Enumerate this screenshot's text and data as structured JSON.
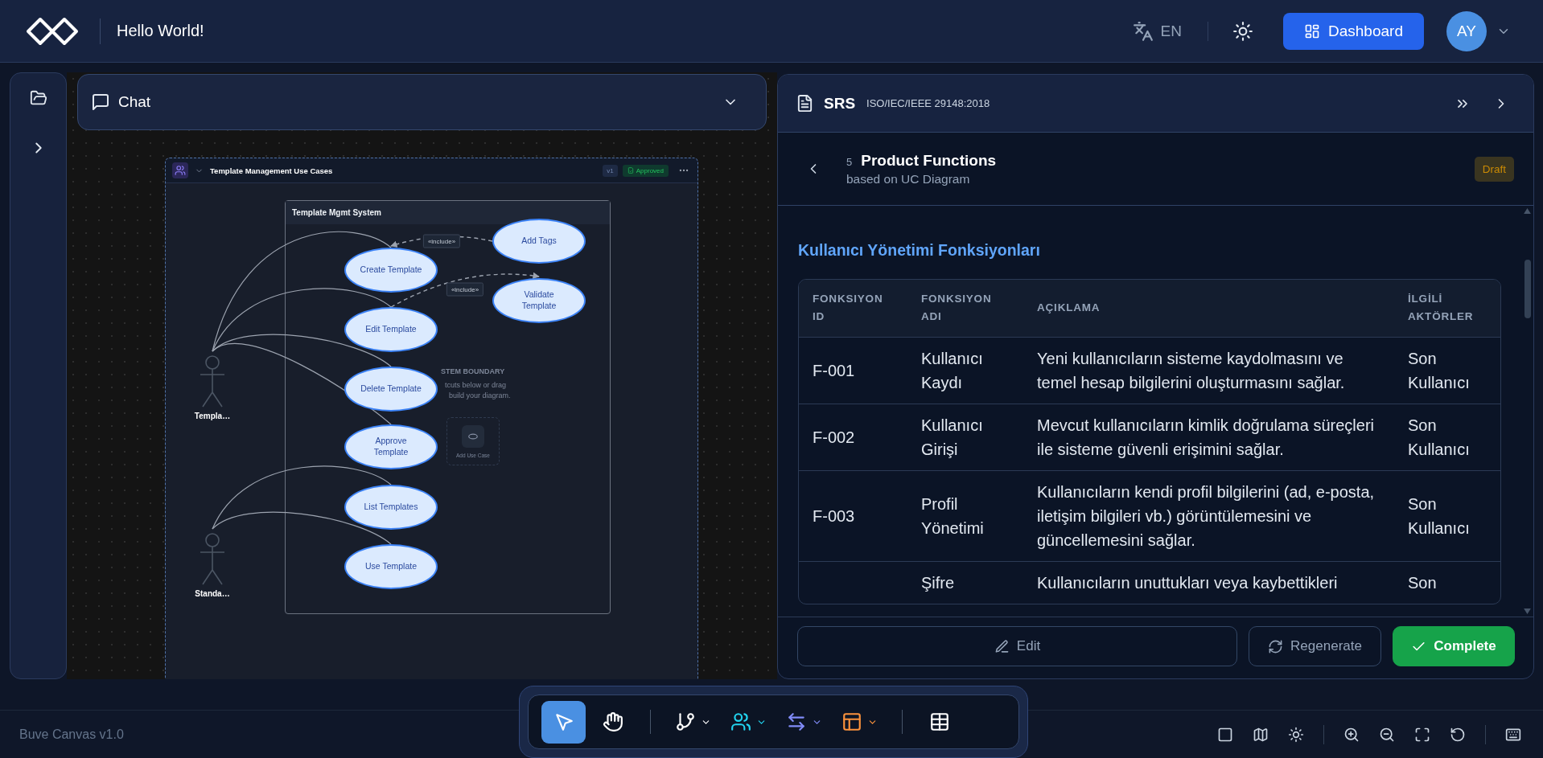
{
  "header": {
    "app_title": "Hello World!",
    "language": "EN",
    "dashboard_button": "Dashboard",
    "avatar_initials": "AY"
  },
  "sidebar": {
    "expanded": false
  },
  "chat": {
    "title": "Chat"
  },
  "diagram": {
    "title": "Template Management Use Cases",
    "version": "v1",
    "status": "Approved",
    "boundary_title": "Template Mgmt System",
    "hint_lines": [
      "STEM BOUNDARY",
      "tcuts below or drag",
      "build your diagram."
    ],
    "add_use_case": "Add Use Case",
    "use_cases": [
      {
        "label": "Create Template"
      },
      {
        "label": "Edit Template"
      },
      {
        "label": "Delete Template"
      },
      {
        "label": "Approve Template"
      },
      {
        "label": "List Templates"
      },
      {
        "label": "Use Template"
      },
      {
        "label": "Add Tags"
      },
      {
        "label": "Validate Template"
      }
    ],
    "actors": [
      {
        "label": "Templa…"
      },
      {
        "label": "Standa…"
      }
    ],
    "include_labels": [
      "«include»",
      "«include»"
    ]
  },
  "srs": {
    "title": "SRS",
    "standard": "ISO/IEC/IEEE 29148:2018",
    "section_number": "5",
    "section_title": "Product Functions",
    "section_subtitle": "based on UC Diagram",
    "status": "Draft",
    "heading": "Kullanıcı Yönetimi Fonksiyonları",
    "columns": [
      "FONKSIYON ID",
      "FONKSIYON ADI",
      "AÇIKLAMA",
      "İLGİLİ AKTÖRLER"
    ],
    "rows": [
      {
        "id": "F-001",
        "name": "Kullanıcı Kaydı",
        "description": "Yeni kullanıcıların sisteme kaydolmasını ve temel hesap bilgilerini oluşturmasını sağlar.",
        "actors": "Son Kullanıcı"
      },
      {
        "id": "F-002",
        "name": "Kullanıcı Girişi",
        "description": "Mevcut kullanıcıların kimlik doğrulama süreçleri ile sisteme güvenli erişimini sağlar.",
        "actors": "Son Kullanıcı"
      },
      {
        "id": "F-003",
        "name": "Profil Yönetimi",
        "description": "Kullanıcıların kendi profil bilgilerini (ad, e-posta, iletişim bilgileri vb.) görüntülemesini ve güncellemesini sağlar.",
        "actors": "Son Kullanıcı"
      },
      {
        "name": "Şifre",
        "description": "Kullanıcıların unuttukları veya kaybettikleri",
        "actors": "Son"
      }
    ],
    "buttons": {
      "edit": "Edit",
      "regenerate": "Regenerate",
      "complete": "Complete"
    }
  },
  "toolbar": {
    "groups": [
      [
        {
          "kind": "select",
          "selected": true
        },
        {
          "kind": "pan",
          "selected": false
        }
      ],
      [
        {
          "kind": "branch",
          "selected": false
        },
        {
          "kind": "actors",
          "selected": false
        },
        {
          "kind": "relations",
          "selected": false
        },
        {
          "kind": "layout",
          "selected": false
        }
      ],
      [
        {
          "kind": "table",
          "selected": false
        }
      ]
    ]
  },
  "footer": {
    "version": "Buve Canvas v1.0"
  }
}
